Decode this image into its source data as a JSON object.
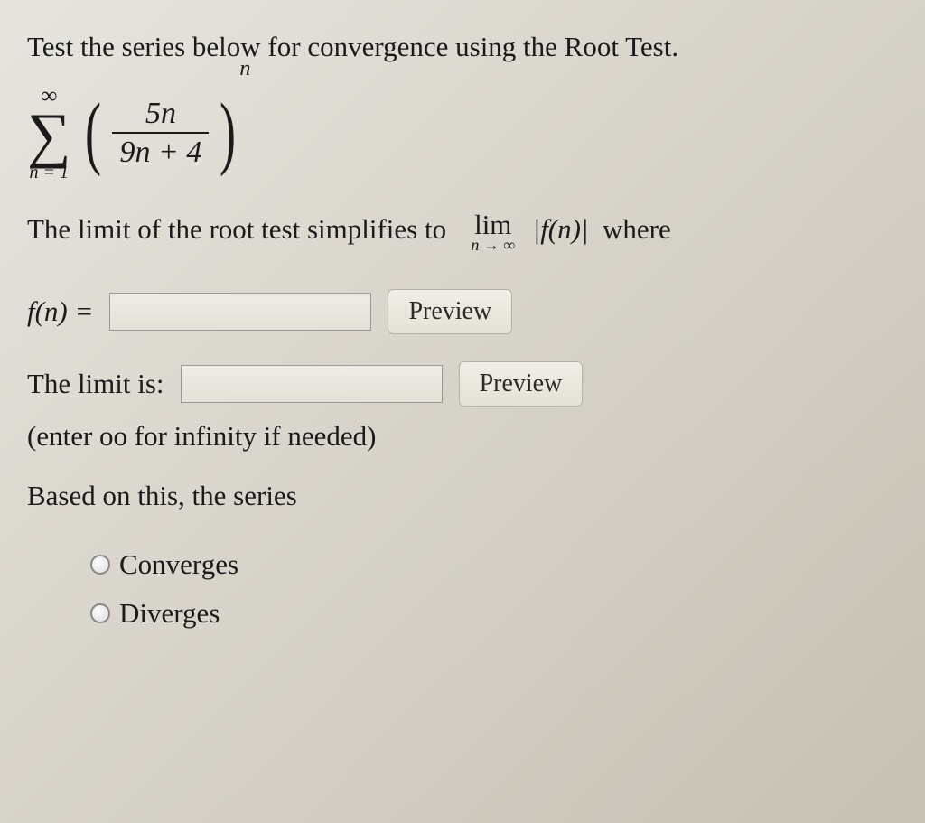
{
  "question": {
    "prompt": "Test the series below for convergence using the Root Test.",
    "series": {
      "summation_upper": "∞",
      "summation_lower": "n = 1",
      "numerator": "5n",
      "denominator": "9n + 4",
      "exponent": "n"
    },
    "limit_sentence_prefix": "The limit of the root test simplifies to",
    "limit_expr_lim": "lim",
    "limit_expr_sub": "n → ∞",
    "limit_expr_body": "|f(n)|",
    "limit_sentence_suffix": "where"
  },
  "inputs": {
    "fn_label": "f(n) =",
    "fn_value": "",
    "preview1": "Preview",
    "limit_label": "The limit is:",
    "limit_value": "",
    "preview2": "Preview",
    "hint": "(enter oo for infinity if needed)"
  },
  "conclusion": {
    "based_text": "Based on this, the series",
    "options": {
      "converges": "Converges",
      "diverges": "Diverges"
    }
  }
}
